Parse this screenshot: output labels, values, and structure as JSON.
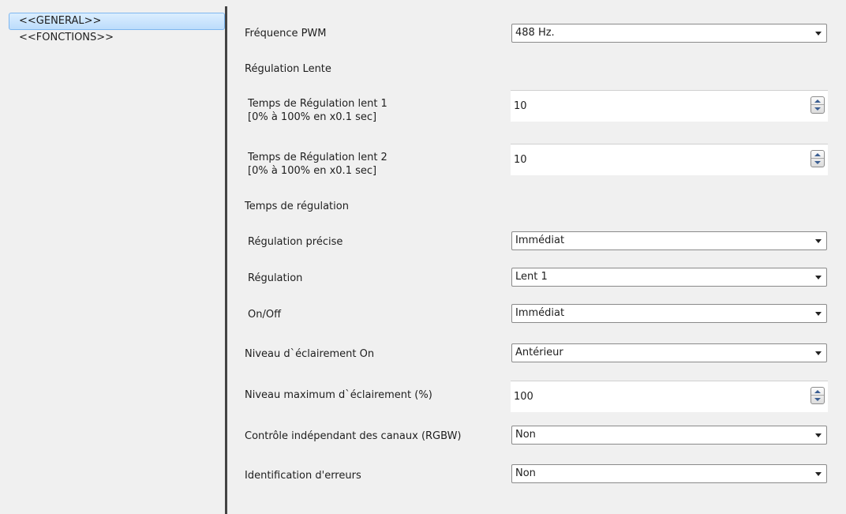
{
  "sidebar": {
    "items": [
      {
        "label": "<<GENERAL>>"
      },
      {
        "label": "<<FONCTIONS>>"
      }
    ]
  },
  "params": {
    "pwm": {
      "label": "Fréquence PWM",
      "value": "488 Hz."
    },
    "slow_section": {
      "label": "Régulation Lente"
    },
    "slow1": {
      "label": "Temps de Régulation lent 1",
      "sub": "[0% à 100% en x0.1 sec]",
      "value": "10"
    },
    "slow2": {
      "label": "Temps de Régulation lent 2",
      "sub": "[0% à 100% en x0.1 sec]",
      "value": "10"
    },
    "reg_time_section": {
      "label": "Temps de régulation"
    },
    "precise": {
      "label": "Régulation précise",
      "value": "Immédiat"
    },
    "regulation": {
      "label": "Régulation",
      "value": "Lent 1"
    },
    "onoff": {
      "label": "On/Off",
      "value": "Immédiat"
    },
    "level_on": {
      "label": "Niveau d`éclairement On",
      "value": "Antérieur"
    },
    "max_level": {
      "label": "Niveau maximum d`éclairement (%)",
      "value": "100"
    },
    "independent": {
      "label": "Contrôle indépendant des canaux (RGBW)",
      "value": "Non"
    },
    "errors": {
      "label": "Identification d'erreurs",
      "value": "Non"
    }
  },
  "colors": {
    "selection": "#bcdcfb",
    "splitter": "#444444",
    "spin_arrow": "#3b5e91"
  }
}
